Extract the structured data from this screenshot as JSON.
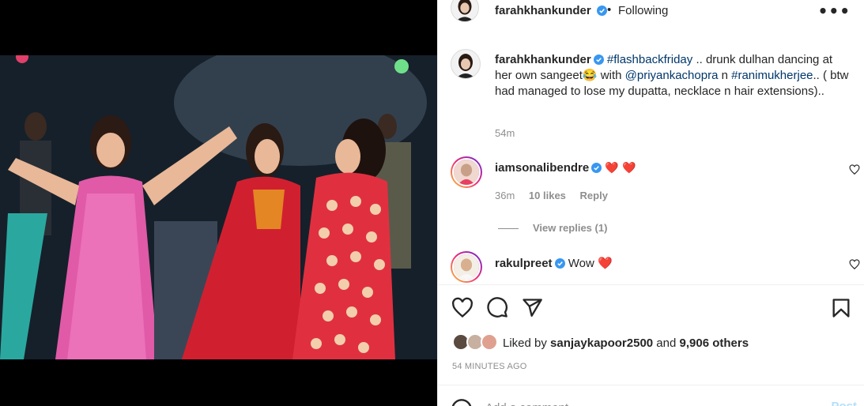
{
  "post": {
    "username": "farahkhankunder",
    "dot": "•",
    "follow_label": "Following",
    "more_label": "•••"
  },
  "caption": {
    "username": "farahkhankunder",
    "hashtag1": "#flashbackfriday",
    "text1": " .. drunk dulhan dancing at her own sangeet",
    "emoji": "😂",
    "text2": " with ",
    "mention1": "@priyankachopra",
    "text3": " n ",
    "mention2": "#ranimukherjee",
    "text4": ".. ( btw had managed to lose my dupatta, necklace n hair extensions)..",
    "time": "54m"
  },
  "comments": [
    {
      "username": "iamsonalibendre",
      "text": "❤️ ❤️",
      "time": "36m",
      "likes": "10 likes",
      "reply_label": "Reply"
    },
    {
      "username": "rakulpreet",
      "text": "Wow ❤️"
    }
  ],
  "view_replies_label": "View replies (1)",
  "liked_by": {
    "prefix": "Liked by ",
    "user": "sanjaykapoor2500",
    "middle": " and ",
    "others": "9,906 others"
  },
  "time_ago": "54 MINUTES AGO",
  "add_comment": {
    "placeholder": "Add a comment...",
    "post_label": "Post"
  },
  "icons": {
    "like": "heart-icon",
    "comment": "comment-icon",
    "share": "paper-plane-icon",
    "save": "bookmark-icon",
    "emoji": "emoji-icon",
    "verified": "verified-badge-icon"
  },
  "colors": {
    "verified": "#3897f0",
    "heart": "#ed4956",
    "link": "#00376b",
    "secondary_text": "#8e8e8e"
  }
}
